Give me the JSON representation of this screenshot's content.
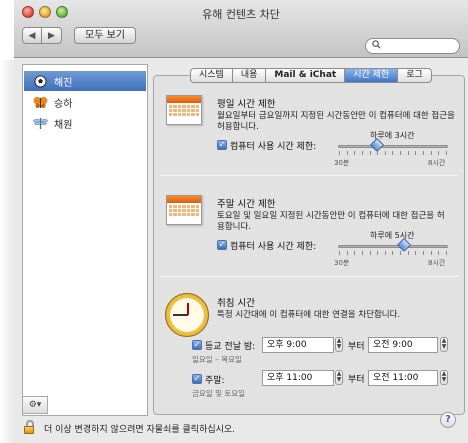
{
  "window": {
    "title": "유해 컨텐츠 차단"
  },
  "toolbar": {
    "back_glyph": "◀",
    "forward_glyph": "▶",
    "show_all": "모두 보기",
    "search_placeholder": "",
    "search_icon": "magnifier-icon"
  },
  "sidebar": {
    "items": [
      {
        "label": "해진",
        "icon": "soccer-ball-icon",
        "selected": true
      },
      {
        "label": "승하",
        "icon": "butterfly-icon",
        "selected": false
      },
      {
        "label": "채원",
        "icon": "dragonfly-icon",
        "selected": false
      }
    ],
    "action_button": "⚙▾"
  },
  "tabs": [
    "시스템",
    "내용",
    "Mail & iChat",
    "시간 제한",
    "로그"
  ],
  "active_tab": "시간 제한",
  "weekday": {
    "title": "평일 시간 제한",
    "desc_line1": "월요일부터 금요일까지 지정된 시간동안만 이 컴퓨터에 대한 접근을",
    "desc_line2": "허용합니다.",
    "checkbox_label": "컴퓨터 사용 시간 제한:",
    "checked": true,
    "slider_caption": "하루에 3시간",
    "slider_min": "30분",
    "slider_max": "8시간",
    "slider_fraction": 0.35
  },
  "weekend": {
    "title": "주말 시간 제한",
    "desc_line1": "토요일 및 일요일 지정된 시간동안만 이 컴퓨터에 대한 접근을 허",
    "desc_line2": "용합니다.",
    "checkbox_label": "컴퓨터 사용 시간 제한:",
    "checked": true,
    "slider_caption": "하루에 5시간",
    "slider_min": "30분",
    "slider_max": "8시간",
    "slider_fraction": 0.6
  },
  "bedtime": {
    "title": "취침 시간",
    "desc": "특정 시간대에 이 컴퓨터에 대한 연결을 차단합니다.",
    "school_nights": {
      "label": "등교 전날 밤:",
      "note": "일요일 – 목요일",
      "from": "오후  9:00",
      "to_label": "부터",
      "to": "오전  9:00",
      "checked": true
    },
    "weekend": {
      "label": "주말:",
      "note": "금요일 및 토요일",
      "from": "오후 11:00",
      "to_label": "부터",
      "to": "오전 11:00",
      "checked": true
    }
  },
  "footer": {
    "lock_text": "더 이상 변경하지 않으려면 자물쇠를 클릭하십시오.",
    "help": "?"
  },
  "colors": {
    "accent": "#3f76c8",
    "calendar": "#d85e10"
  }
}
